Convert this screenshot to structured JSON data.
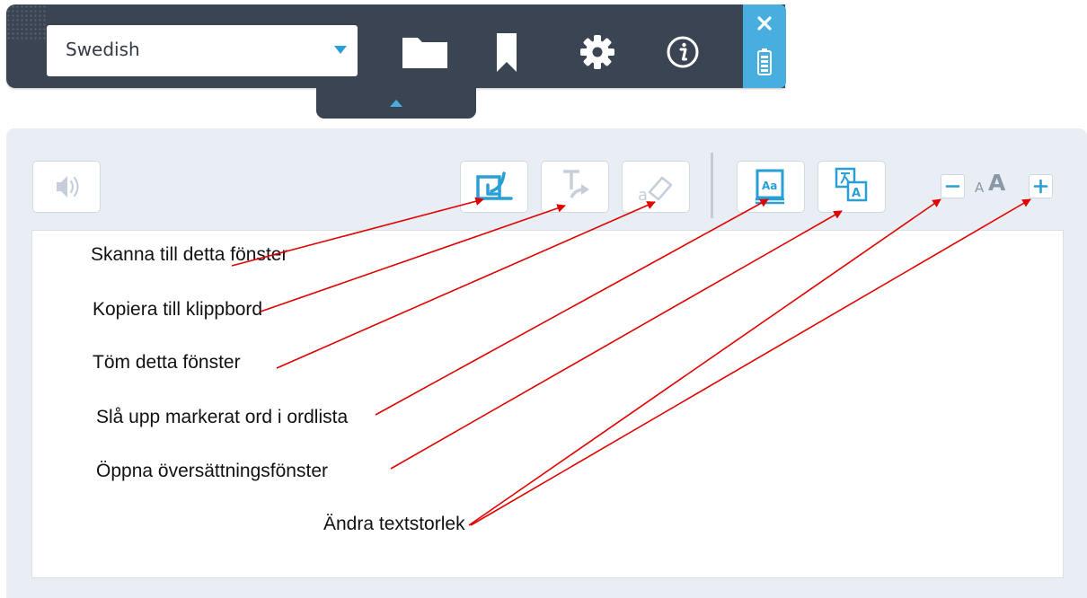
{
  "toolbar": {
    "language": {
      "value": "Swedish"
    },
    "icons": [
      "folder-icon",
      "bookmark-icon",
      "gear-icon",
      "info-icon"
    ]
  },
  "side_panel": {
    "icons": [
      "close-icon",
      "battery-icon"
    ]
  },
  "panel": {
    "font_size": {
      "small_glyph": "A",
      "large_glyph": "A",
      "decrease": "−",
      "increase": "+"
    }
  },
  "annotations": {
    "scan": "Skanna till detta fönster",
    "copy": "Kopiera till klippbord",
    "clear": "Töm detta fönster",
    "lookup": "Slå upp markerat ord i ordlista",
    "translate": "Öppna översättningsfönster",
    "text_size": "Ändra textstorlek"
  },
  "colors": {
    "toolbar": "#3b4452",
    "accent": "#47aedf",
    "panel": "#e9eef4",
    "arrow": "#e00000"
  }
}
